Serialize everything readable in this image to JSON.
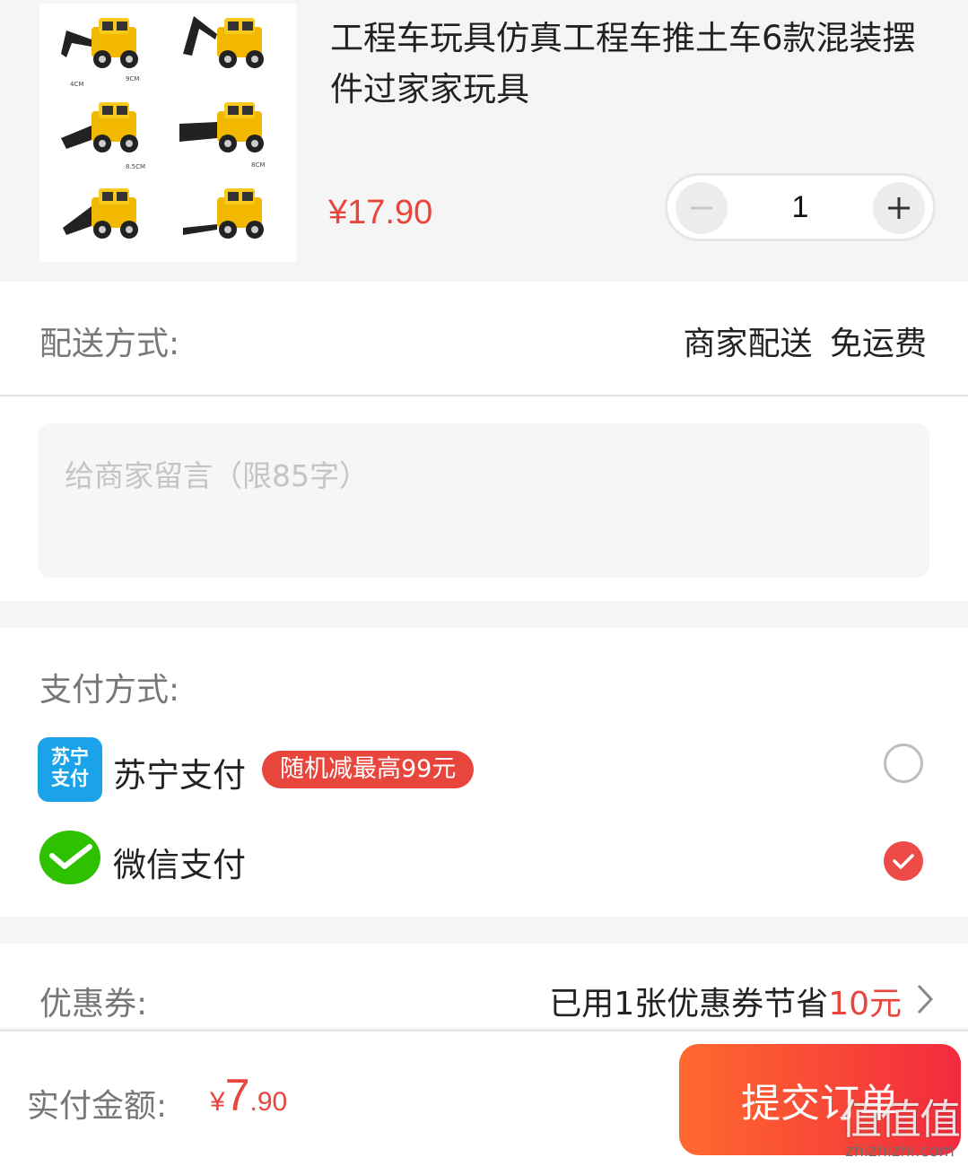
{
  "product": {
    "title": "工程车玩具仿真工程车推土车6款混装摆件过家家玩具",
    "price": "¥17.90",
    "quantity": "1",
    "image_labels": [
      "4CM",
      "9CM",
      "4CM",
      "8.5CM",
      "8CM"
    ]
  },
  "delivery": {
    "label": "配送方式:",
    "value": "商家配送  免运费"
  },
  "message": {
    "placeholder": "给商家留言（限85字）"
  },
  "payment": {
    "label": "支付方式:",
    "options": [
      {
        "icon_text": "苏宁支付",
        "name": "苏宁支付",
        "promo": "随机减最高99元",
        "selected": false
      },
      {
        "name": "微信支付",
        "selected": true
      }
    ]
  },
  "coupon": {
    "label": "优惠券:",
    "value_prefix": "已用1张优惠券节省",
    "value_amount": "10元"
  },
  "bottom": {
    "total_label": "实付金额:",
    "currency": "¥",
    "total_int": "7",
    "total_dec": ".90",
    "submit_label": "提交订单"
  },
  "watermark": {
    "logo": "值值值",
    "domain": "zhizhizhi.com"
  },
  "colors": {
    "accent": "#e8453c",
    "suning_blue": "#1aa3e8",
    "wechat_green": "#2dc100",
    "check_red": "#ec4b48"
  }
}
